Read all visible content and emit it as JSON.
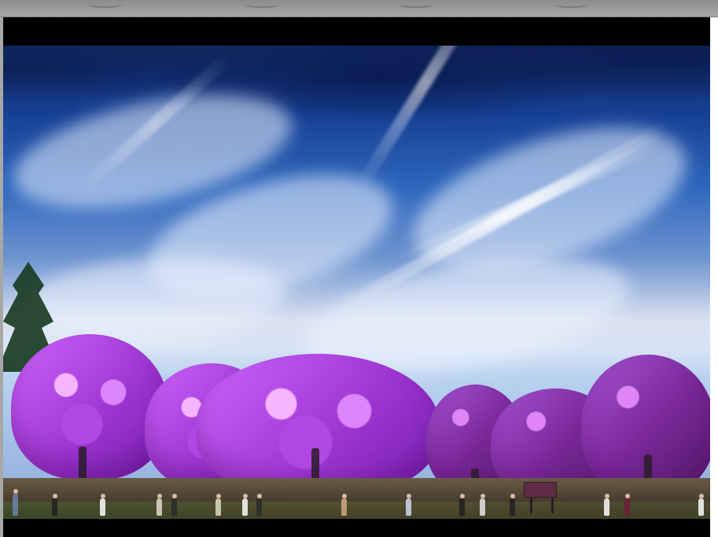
{
  "image": {
    "description": "",
    "colors": {
      "sky_top": "#10285f",
      "sky_mid": "#2e67bd",
      "sky_light": "#d9e1f0",
      "blossom": "#c36cec",
      "blossom_dark": "#6a2499",
      "ground": "#4f4232"
    }
  },
  "viewer": {
    "top_strip_marks": [
      "",
      "",
      "",
      ""
    ]
  }
}
